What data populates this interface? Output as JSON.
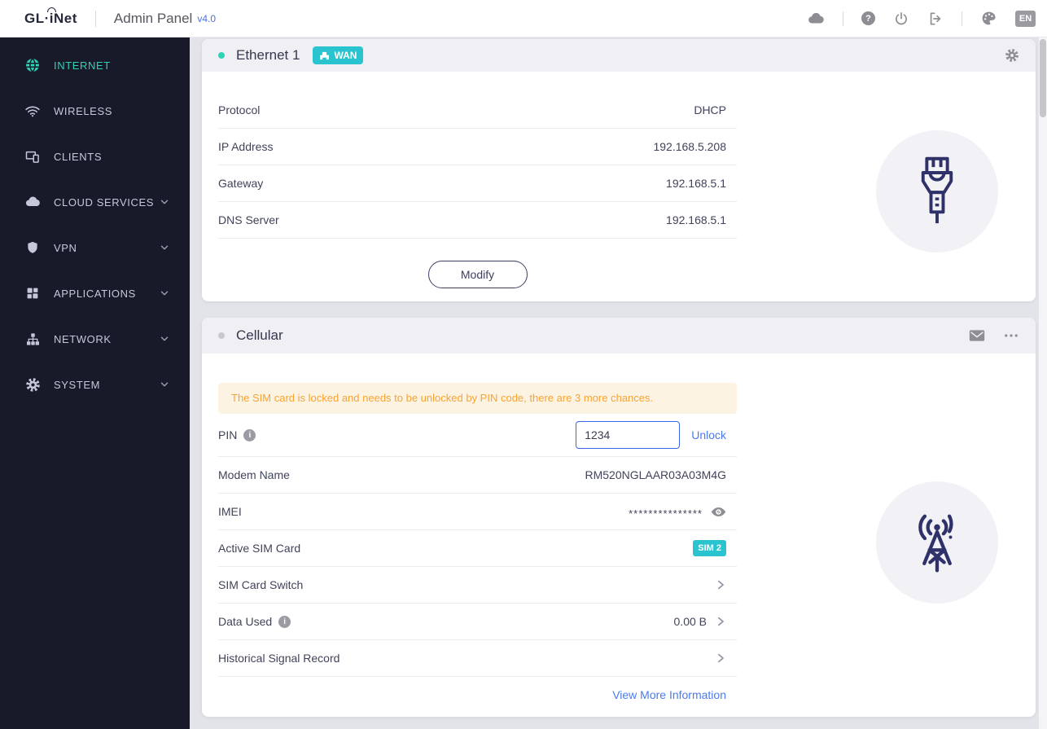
{
  "header": {
    "logo_prefix": "GL·",
    "logo_i": "i",
    "logo_suffix": "Net",
    "title": "Admin Panel",
    "version": "v4.0",
    "language": "EN",
    "icons": [
      "cloud-icon",
      "help-icon",
      "power-icon",
      "logout-icon",
      "theme-icon"
    ]
  },
  "sidebar": {
    "items": [
      {
        "label": "INTERNET",
        "icon": "globe-icon",
        "active": true,
        "expandable": false
      },
      {
        "label": "WIRELESS",
        "icon": "wifi-icon",
        "active": false,
        "expandable": false
      },
      {
        "label": "CLIENTS",
        "icon": "devices-icon",
        "active": false,
        "expandable": false
      },
      {
        "label": "CLOUD SERVICES",
        "icon": "cloud-icon",
        "active": false,
        "expandable": true
      },
      {
        "label": "VPN",
        "icon": "shield-icon",
        "active": false,
        "expandable": true
      },
      {
        "label": "APPLICATIONS",
        "icon": "grid-icon",
        "active": false,
        "expandable": true
      },
      {
        "label": "NETWORK",
        "icon": "sitemap-icon",
        "active": false,
        "expandable": true
      },
      {
        "label": "SYSTEM",
        "icon": "gear-icon",
        "active": false,
        "expandable": true
      }
    ]
  },
  "ethernet": {
    "title": "Ethernet 1",
    "badge": "WAN",
    "status": "connected",
    "rows": [
      {
        "label": "Protocol",
        "value": "DHCP"
      },
      {
        "label": "IP Address",
        "value": "192.168.5.208"
      },
      {
        "label": "Gateway",
        "value": "192.168.5.1"
      },
      {
        "label": "DNS Server",
        "value": "192.168.5.1"
      }
    ],
    "modify_label": "Modify"
  },
  "cellular": {
    "title": "Cellular",
    "status": "disconnected",
    "warning": "The SIM card is locked and needs to be unlocked by PIN code, there are 3 more chances.",
    "pin_label": "PIN",
    "pin_value": "1234",
    "unlock_label": "Unlock",
    "rows": [
      {
        "label": "Modem Name",
        "value": "RM520NGLAAR03A03M4G"
      },
      {
        "label": "IMEI",
        "value": "***************"
      },
      {
        "label": "Active SIM Card",
        "badge": "SIM 2"
      },
      {
        "label": "SIM Card Switch",
        "value": ""
      },
      {
        "label": "Data Used",
        "value": "0.00 B"
      },
      {
        "label": "Historical Signal Record",
        "value": ""
      }
    ],
    "view_more_label": "View More Information"
  },
  "colors": {
    "accent_teal": "#2ed3b7",
    "badge_teal": "#29c4d0",
    "link_blue": "#4a7bf0",
    "warning_bg": "#fdf3e3",
    "warning_text": "#f7a433",
    "sidebar_bg": "#181a29",
    "icon_navy": "#2f3268"
  }
}
